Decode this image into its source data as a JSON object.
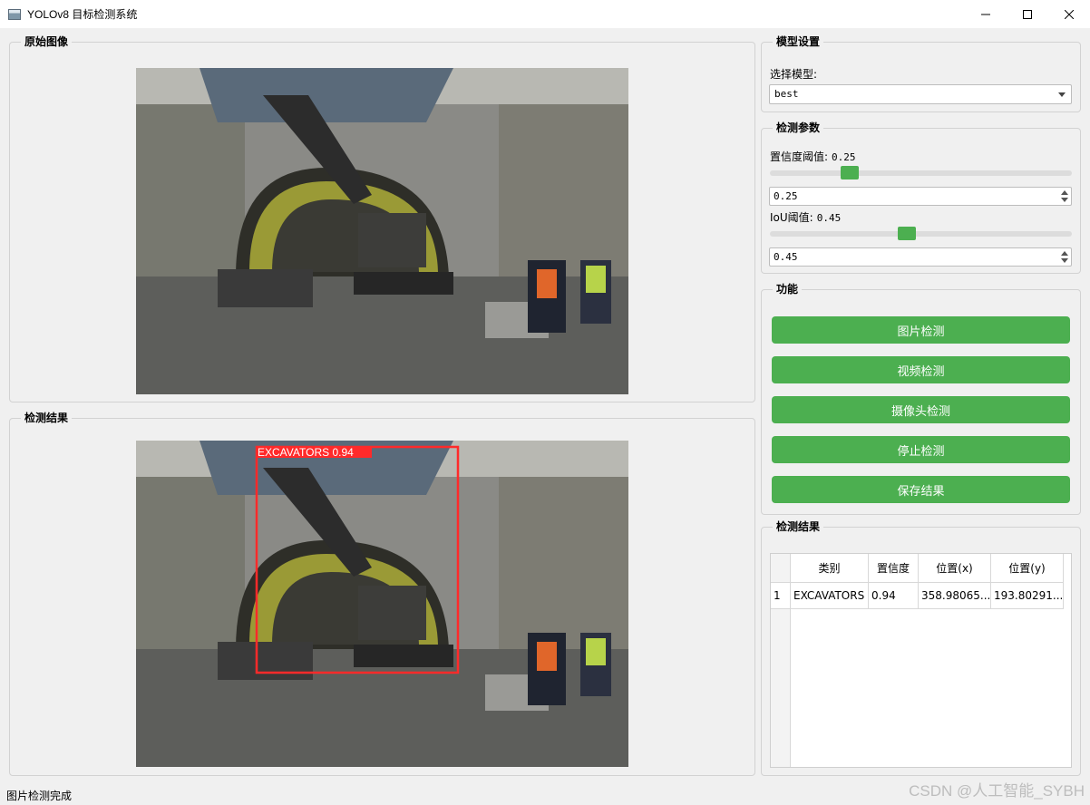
{
  "window": {
    "title": "YOLOv8 目标检测系统"
  },
  "original_image": {
    "group_title": "原始图像"
  },
  "result_image": {
    "group_title": "检测结果",
    "detection_label": "EXCAVATORS  0.94",
    "box_color": "#ff2a2a"
  },
  "model_settings": {
    "group_title": "模型设置",
    "select_label": "选择模型:",
    "selected_model": "best"
  },
  "detection_params": {
    "group_title": "检测参数",
    "confidence_label": "置信度阈值:",
    "confidence_value": "0.25",
    "confidence_fraction": 0.25,
    "confidence_spin": "0.25",
    "iou_label": "IoU阈值:",
    "iou_value": "0.45",
    "iou_fraction": 0.45,
    "iou_spin": "0.45"
  },
  "functions": {
    "group_title": "功能",
    "buttons": [
      "图片检测",
      "视频检测",
      "摄像头检测",
      "停止检测",
      "保存结果"
    ],
    "button_color": "#4caf50"
  },
  "results_table": {
    "group_title": "检测结果",
    "columns": [
      "类别",
      "置信度",
      "位置(x)",
      "位置(y)"
    ],
    "rows": [
      {
        "index": "1",
        "class": "EXCAVATORS",
        "confidence": "0.94",
        "x": "358.98065...",
        "y": "193.80291..."
      }
    ]
  },
  "status_bar": {
    "message": "图片检测完成"
  },
  "watermark": "CSDN @人工智能_SYBH"
}
